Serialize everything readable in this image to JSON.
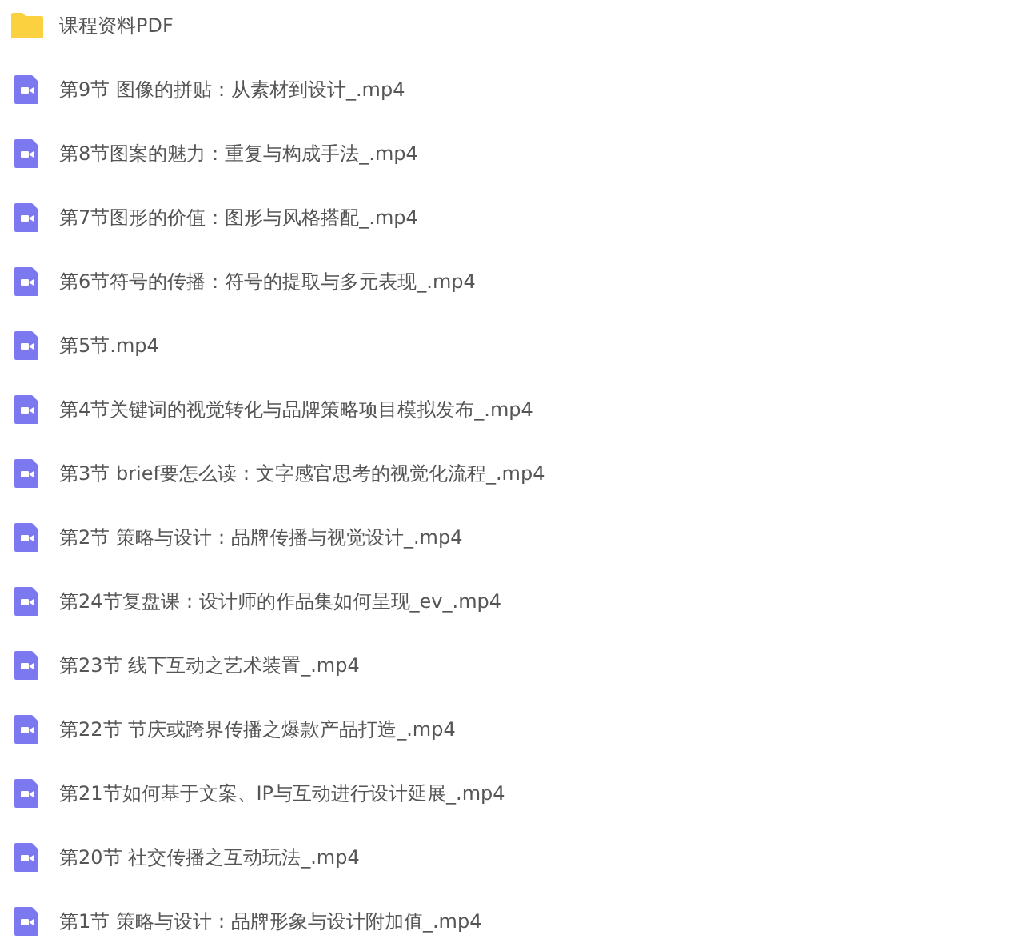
{
  "files": [
    {
      "kind": "folder",
      "name": "课程资料PDF"
    },
    {
      "kind": "video",
      "name": "第9节 图像的拼贴：从素材到设计_.mp4"
    },
    {
      "kind": "video",
      "name": "第8节图案的魅力：重复与构成手法_.mp4"
    },
    {
      "kind": "video",
      "name": "第7节图形的价值：图形与风格搭配_.mp4"
    },
    {
      "kind": "video",
      "name": "第6节符号的传播：符号的提取与多元表现_.mp4"
    },
    {
      "kind": "video",
      "name": "第5节.mp4"
    },
    {
      "kind": "video",
      "name": "第4节关键词的视觉转化与品牌策略项目模拟发布_.mp4"
    },
    {
      "kind": "video",
      "name": "第3节 brief要怎么读：文字感官思考的视觉化流程_.mp4"
    },
    {
      "kind": "video",
      "name": "第2节 策略与设计：品牌传播与视觉设计_.mp4"
    },
    {
      "kind": "video",
      "name": "第24节复盘课：设计师的作品集如何呈现_ev_.mp4"
    },
    {
      "kind": "video",
      "name": "第23节 线下互动之艺术装置_.mp4"
    },
    {
      "kind": "video",
      "name": "第22节 节庆或跨界传播之爆款产品打造_.mp4"
    },
    {
      "kind": "video",
      "name": "第21节如何基于文案、IP与互动进行设计延展_.mp4"
    },
    {
      "kind": "video",
      "name": "第20节 社交传播之互动玩法_.mp4"
    },
    {
      "kind": "video",
      "name": "第1节 策略与设计：品牌形象与设计附加值_.mp4"
    }
  ]
}
